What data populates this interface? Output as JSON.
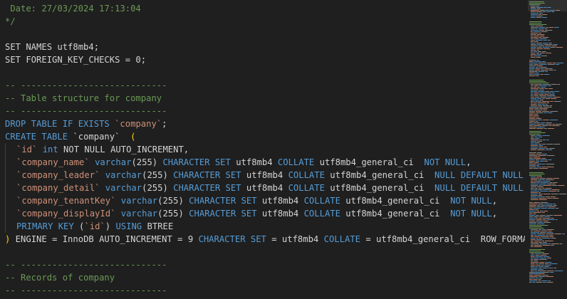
{
  "editor": {
    "lines": [
      [
        {
          "t": " Date: 27/03/2024 17:13:04",
          "c": "comment"
        }
      ],
      [
        {
          "t": "*/",
          "c": "comment"
        }
      ],
      [],
      [
        {
          "t": "SET NAMES utf8mb4;",
          "c": "plain"
        }
      ],
      [
        {
          "t": "SET FOREIGN_KEY_CHECKS = 0;",
          "c": "plain"
        }
      ],
      [],
      [
        {
          "t": "-- ----------------------------",
          "c": "comment"
        }
      ],
      [
        {
          "t": "-- Table structure for company",
          "c": "comment"
        }
      ],
      [
        {
          "t": "-- ----------------------------",
          "c": "comment"
        }
      ],
      [
        {
          "t": "DROP TABLE IF EXISTS ",
          "c": "kw"
        },
        {
          "t": "`company`",
          "c": "ident"
        },
        {
          "t": ";",
          "c": "plain"
        }
      ],
      [
        {
          "t": "CREATE TABLE ",
          "c": "kw"
        },
        {
          "t": "`company`",
          "c": "plain"
        },
        {
          "t": "  ",
          "c": "plain"
        },
        {
          "t": "(",
          "c": "paren"
        }
      ],
      [
        {
          "indent": true
        },
        {
          "t": "`id`",
          "c": "ident"
        },
        {
          "t": " int ",
          "c": "kw"
        },
        {
          "t": "NOT NULL AUTO_INCREMENT,",
          "c": "plain"
        }
      ],
      [
        {
          "indent": true
        },
        {
          "t": "`company_name`",
          "c": "ident"
        },
        {
          "t": " varchar",
          "c": "kw"
        },
        {
          "t": "(255)",
          "c": "plain"
        },
        {
          "t": " CHARACTER SET",
          "c": "kw"
        },
        {
          "t": " utf8mb4 ",
          "c": "plain"
        },
        {
          "t": "COLLATE",
          "c": "kw"
        },
        {
          "t": " utf8mb4_general_ci  ",
          "c": "plain"
        },
        {
          "t": "NOT NULL",
          "c": "kw"
        },
        {
          "t": ",",
          "c": "plain"
        }
      ],
      [
        {
          "indent": true
        },
        {
          "t": "`company_leader`",
          "c": "ident"
        },
        {
          "t": " varchar",
          "c": "kw"
        },
        {
          "t": "(255)",
          "c": "plain"
        },
        {
          "t": " CHARACTER SET",
          "c": "kw"
        },
        {
          "t": " utf8mb4 ",
          "c": "plain"
        },
        {
          "t": "COLLATE",
          "c": "kw"
        },
        {
          "t": " utf8mb4_general_ci  ",
          "c": "plain"
        },
        {
          "t": "NULL DEFAULT NULL",
          "c": "kw"
        }
      ],
      [
        {
          "indent": true
        },
        {
          "t": "`company_detail`",
          "c": "ident"
        },
        {
          "t": " varchar",
          "c": "kw"
        },
        {
          "t": "(255)",
          "c": "plain"
        },
        {
          "t": " CHARACTER SET",
          "c": "kw"
        },
        {
          "t": " utf8mb4 ",
          "c": "plain"
        },
        {
          "t": "COLLATE",
          "c": "kw"
        },
        {
          "t": " utf8mb4_general_ci  ",
          "c": "plain"
        },
        {
          "t": "NULL DEFAULT NULL",
          "c": "kw"
        }
      ],
      [
        {
          "indent": true
        },
        {
          "t": "`company_tenantKey`",
          "c": "ident"
        },
        {
          "t": " varchar",
          "c": "kw"
        },
        {
          "t": "(255)",
          "c": "plain"
        },
        {
          "t": " CHARACTER SET",
          "c": "kw"
        },
        {
          "t": " utf8mb4 ",
          "c": "plain"
        },
        {
          "t": "COLLATE",
          "c": "kw"
        },
        {
          "t": " utf8mb4_general_ci  ",
          "c": "plain"
        },
        {
          "t": "NOT NULL",
          "c": "kw"
        },
        {
          "t": ",",
          "c": "plain"
        }
      ],
      [
        {
          "indent": true
        },
        {
          "t": "`company_displayId`",
          "c": "ident"
        },
        {
          "t": " varchar",
          "c": "kw"
        },
        {
          "t": "(255)",
          "c": "plain"
        },
        {
          "t": " CHARACTER SET",
          "c": "kw"
        },
        {
          "t": " utf8mb4 ",
          "c": "plain"
        },
        {
          "t": "COLLATE",
          "c": "kw"
        },
        {
          "t": " utf8mb4_general_ci  ",
          "c": "plain"
        },
        {
          "t": "NOT NULL",
          "c": "kw"
        },
        {
          "t": ",",
          "c": "plain"
        }
      ],
      [
        {
          "indent": true
        },
        {
          "t": "PRIMARY KEY",
          "c": "kw"
        },
        {
          "t": " (",
          "c": "plain"
        },
        {
          "t": "`id`",
          "c": "ident"
        },
        {
          "t": ")",
          "c": "plain"
        },
        {
          "t": " USING",
          "c": "kw"
        },
        {
          "t": " BTREE",
          "c": "plain"
        }
      ],
      [
        {
          "t": ")",
          "c": "paren"
        },
        {
          "t": " ENGINE = InnoDB AUTO_INCREMENT = 9 ",
          "c": "plain"
        },
        {
          "t": "CHARACTER SET",
          "c": "kw"
        },
        {
          "t": " = utf8mb4 ",
          "c": "plain"
        },
        {
          "t": "COLLATE",
          "c": "kw"
        },
        {
          "t": " = utf8mb4_general_ci  ROW_FORMA",
          "c": "plain"
        }
      ],
      [],
      [
        {
          "t": "-- ----------------------------",
          "c": "comment"
        }
      ],
      [
        {
          "t": "-- Records of company",
          "c": "comment"
        }
      ],
      [
        {
          "t": "-- ----------------------------",
          "c": "comment"
        }
      ]
    ]
  },
  "minimap": {
    "colors": {
      "comment": "#6a9955",
      "kw": "#569cd6",
      "ident": "#ce9178",
      "plain": "#9c9c9c"
    }
  }
}
